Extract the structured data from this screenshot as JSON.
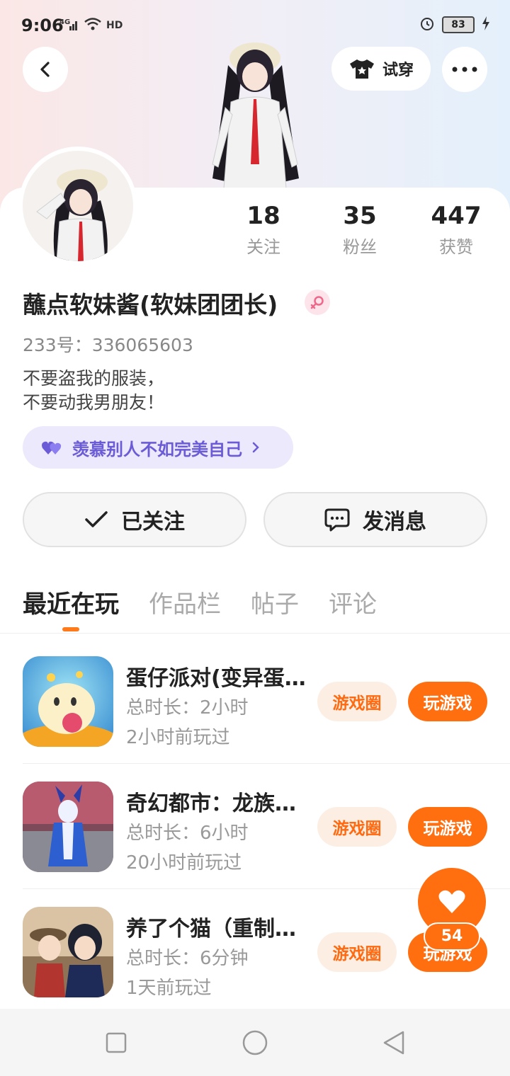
{
  "status": {
    "time": "9:06",
    "signal_label": "4G",
    "hd_label": "HD",
    "battery": "83",
    "icons": [
      "signal-icon",
      "wifi-icon",
      "hd-call-icon",
      "alarm-icon",
      "battery-icon",
      "charging-icon"
    ]
  },
  "header": {
    "try_on_label": "试穿",
    "icons": [
      "back-icon",
      "shirt-icon",
      "more-icon"
    ]
  },
  "profile": {
    "stats": [
      {
        "value": "18",
        "label": "关注"
      },
      {
        "value": "35",
        "label": "粉丝"
      },
      {
        "value": "447",
        "label": "获赞"
      }
    ],
    "username": "蘸点软妹酱(软妹团团长)",
    "gender_icon": "female-icon",
    "uid": "233号：336065603",
    "bio_line1": "不要盗我的服装，",
    "bio_line2": "不要动我男朋友！",
    "motto": "羡慕别人不如完美自己"
  },
  "actions": {
    "follow_label": "已关注",
    "message_label": "发消息"
  },
  "tabs": [
    "最近在玩",
    "作品栏",
    "帖子",
    "评论"
  ],
  "games": [
    {
      "name": "蛋仔派对(变异蛋…",
      "duration": "总时长：2小时",
      "last_played": "2小时前玩过",
      "circle_label": "游戏圈",
      "play_label": "玩游戏"
    },
    {
      "name": "奇幻都市：龙族…",
      "duration": "总时长：6小时",
      "last_played": "20小时前玩过",
      "circle_label": "游戏圈",
      "play_label": "玩游戏"
    },
    {
      "name": "养了个猫（重制…",
      "duration": "总时长：6分钟",
      "last_played": "1天前玩过",
      "circle_label": "游戏圈",
      "play_label": "玩游戏"
    }
  ],
  "like": {
    "count": "54"
  },
  "colors": {
    "accent": "#ff6e0f",
    "motto_text": "#6b5bd6",
    "motto_bg": "#ebe9fb"
  }
}
